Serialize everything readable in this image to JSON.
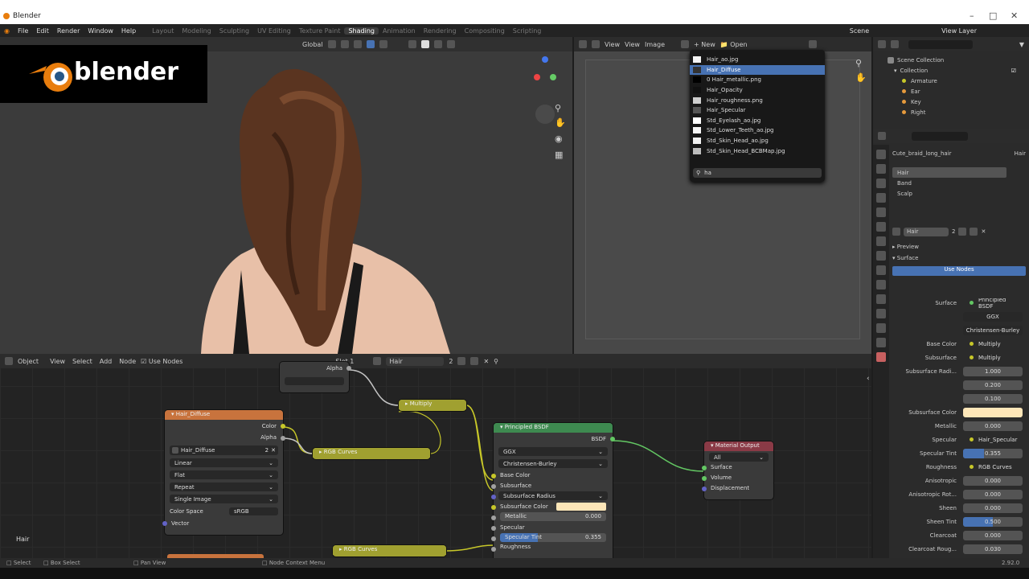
{
  "window": {
    "title": "Blender"
  },
  "menu": {
    "items": [
      "File",
      "Edit",
      "Render",
      "Window",
      "Help"
    ],
    "workspaces": [
      "Layout",
      "Modeling",
      "Sculpting",
      "UV Editing",
      "Texture Paint",
      "Shading",
      "Animation",
      "Rendering",
      "Compositing",
      "Scripting"
    ],
    "active": "Shading",
    "scene": "Scene",
    "view_layer": "View Layer"
  },
  "viewport": {
    "transform": "Global",
    "logo": "blender"
  },
  "image_editor": {
    "view": "View",
    "view2": "View",
    "image": "Image",
    "new": "New",
    "open": "Open"
  },
  "image_popup": {
    "items": [
      {
        "name": "Hair_ao.jpg",
        "swatch": "#f4f4f4"
      },
      {
        "name": "Hair_Diffuse",
        "swatch": "#333333",
        "selected": true
      },
      {
        "name": "0 Hair_metallic.png",
        "swatch": "#000000"
      },
      {
        "name": "Hair_Opacity",
        "swatch": "#111111"
      },
      {
        "name": "Hair_roughness.png",
        "swatch": "#cfcfcf"
      },
      {
        "name": "Hair_Specular",
        "swatch": "#555555"
      },
      {
        "name": "Std_Eyelash_ao.jpg",
        "swatch": "#ffffff"
      },
      {
        "name": "Std_Lower_Teeth_ao.jpg",
        "swatch": "#f7f7f7"
      },
      {
        "name": "Std_Skin_Head_ao.jpg",
        "swatch": "#f2f2f2"
      },
      {
        "name": "Std_Skin_Head_BCBMap.jpg",
        "swatch": "#bdbdbd"
      }
    ],
    "search": "ha"
  },
  "outliner": {
    "scene_collection": "Scene Collection",
    "collection": "Collection",
    "items": [
      "Armature",
      "Ear",
      "Key",
      "Right"
    ]
  },
  "properties": {
    "object": "Cute_braid_long_hair",
    "material_tab": "Hair",
    "slots": [
      "Hair",
      "Band",
      "Scalp"
    ],
    "material": "Hair",
    "users": "2",
    "preview": "Preview",
    "surface": "Surface",
    "use_nodes": "Use Nodes",
    "rows": [
      {
        "label": "Surface",
        "value": "Principled BSDF",
        "type": "link",
        "color": "#63c763"
      },
      {
        "label": "",
        "value": "GGX",
        "type": "dd"
      },
      {
        "label": "",
        "value": "Christensen-Burley",
        "type": "dd"
      },
      {
        "label": "Base Color",
        "value": "Multiply",
        "type": "link",
        "color": "#c7c729"
      },
      {
        "label": "Subsurface",
        "value": "Multiply",
        "type": "link",
        "color": "#c7c729"
      },
      {
        "label": "Subsurface Radi...",
        "value": "1.000",
        "type": "num"
      },
      {
        "label": "",
        "value": "0.200",
        "type": "num"
      },
      {
        "label": "",
        "value": "0.100",
        "type": "num"
      },
      {
        "label": "Subsurface Color",
        "value": "",
        "type": "color",
        "color": "#fde6b8"
      },
      {
        "label": "Metallic",
        "value": "0.000",
        "type": "num"
      },
      {
        "label": "Specular",
        "value": "Hair_Specular",
        "type": "link",
        "color": "#c7c729"
      },
      {
        "label": "Specular Tint",
        "value": "0.355",
        "type": "bar",
        "fill": 0.355
      },
      {
        "label": "Roughness",
        "value": "RGB Curves",
        "type": "link",
        "color": "#c7c729"
      },
      {
        "label": "Anisotropic",
        "value": "0.000",
        "type": "num"
      },
      {
        "label": "Anisotropic Rot...",
        "value": "0.000",
        "type": "num"
      },
      {
        "label": "Sheen",
        "value": "0.000",
        "type": "num"
      },
      {
        "label": "Sheen Tint",
        "value": "0.500",
        "type": "bar",
        "fill": 0.5
      },
      {
        "label": "Clearcoat",
        "value": "0.000",
        "type": "num"
      },
      {
        "label": "Clearcoat Roug...",
        "value": "0.030",
        "type": "num"
      }
    ]
  },
  "node_editor": {
    "mode": "Object",
    "menus": [
      "View",
      "Select",
      "Add",
      "Node"
    ],
    "use_nodes": "Use Nodes",
    "slot": "Slot 1",
    "material": "Hair",
    "users": "2",
    "label": "Hair",
    "image_node": {
      "title": "Hair_Diffuse",
      "out_color": "Color",
      "out_alpha": "Alpha",
      "image": "Hair_Diffuse",
      "users": "2",
      "interp": "Linear",
      "proj": "Flat",
      "ext": "Repeat",
      "source": "Single Image",
      "cs_label": "Color Space",
      "cs": "sRGB",
      "vector": "Vector"
    },
    "alpha_node": {
      "out": "Alpha"
    },
    "multiply": "Multiply",
    "rgb_curves": "RGB Curves",
    "rgb_curves2": "RGB Curves",
    "bsdf": {
      "title": "Principled BSDF",
      "out": "BSDF",
      "dist": "GGX",
      "ss_method": "Christensen-Burley",
      "base": "Base Color",
      "subsurface": "Subsurface",
      "ss_radius": "Subsurface Radius",
      "ss_color": "Subsurface Color",
      "metallic": "Metallic",
      "metallic_val": "0.000",
      "specular": "Specular",
      "spec_tint": "Specular Tint",
      "spec_tint_val": "0.355",
      "roughness": "Roughness"
    },
    "output": {
      "title": "Material Output",
      "target": "All",
      "surface": "Surface",
      "volume": "Volume",
      "displacement": "Displacement"
    }
  },
  "status": {
    "select": "Select",
    "box": "Box Select",
    "pan": "Pan View",
    "context": "Node Context Menu",
    "version": "2.92.0"
  }
}
